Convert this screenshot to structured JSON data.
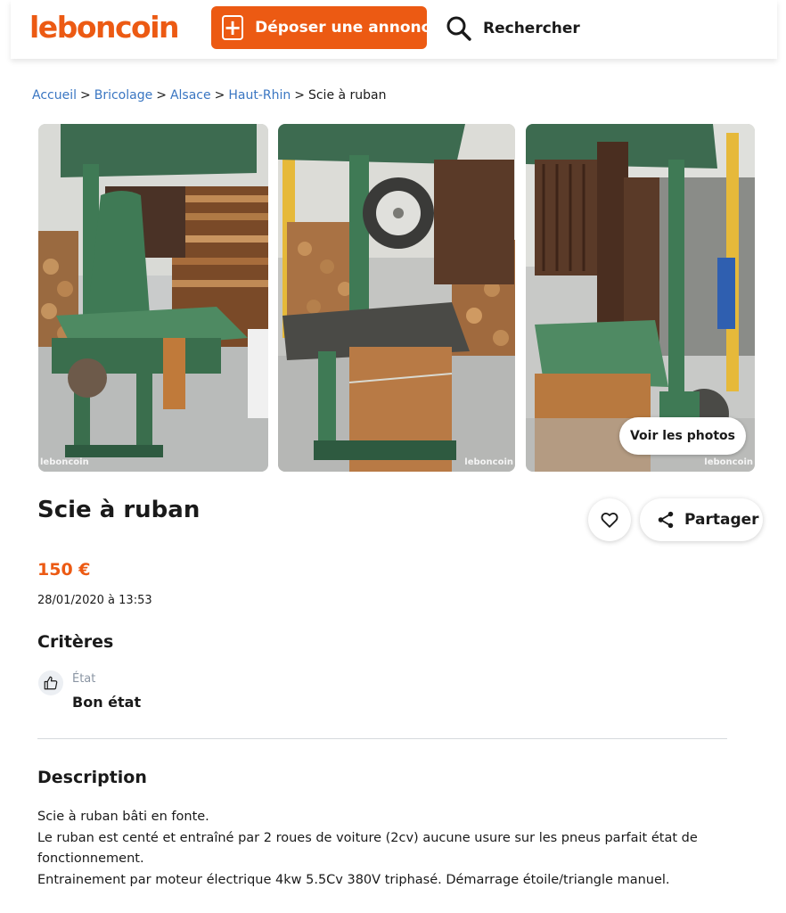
{
  "header": {
    "logo": "leboncoin",
    "post_button": "Déposer une annonce",
    "search_label": "Rechercher",
    "brand_color": "#ec5a13"
  },
  "breadcrumb": {
    "items": [
      "Accueil",
      "Bricolage",
      "Alsace",
      "Haut-Rhin"
    ],
    "current": "Scie à ruban",
    "separator": ">"
  },
  "gallery": {
    "watermark": "leboncoin",
    "see_photos_button": "Voir les photos"
  },
  "ad": {
    "title": "Scie à ruban",
    "price": "150 €",
    "date": "28/01/2020 à 13:53",
    "share_label": "Partager"
  },
  "criteria": {
    "title": "Critères",
    "items": [
      {
        "label": "État",
        "value": "Bon état",
        "icon": "thumbs-up-icon"
      }
    ]
  },
  "description": {
    "title": "Description",
    "lines": [
      "Scie à ruban bâti en fonte.",
      "Le ruban est centé et entraîné par 2 roues de voiture (2cv) aucune usure sur les pneus parfait état de",
      "fonctionnement.",
      "Entrainement par moteur électrique 4kw 5.5Cv 380V triphasé. Démarrage étoile/triangle manuel."
    ]
  }
}
